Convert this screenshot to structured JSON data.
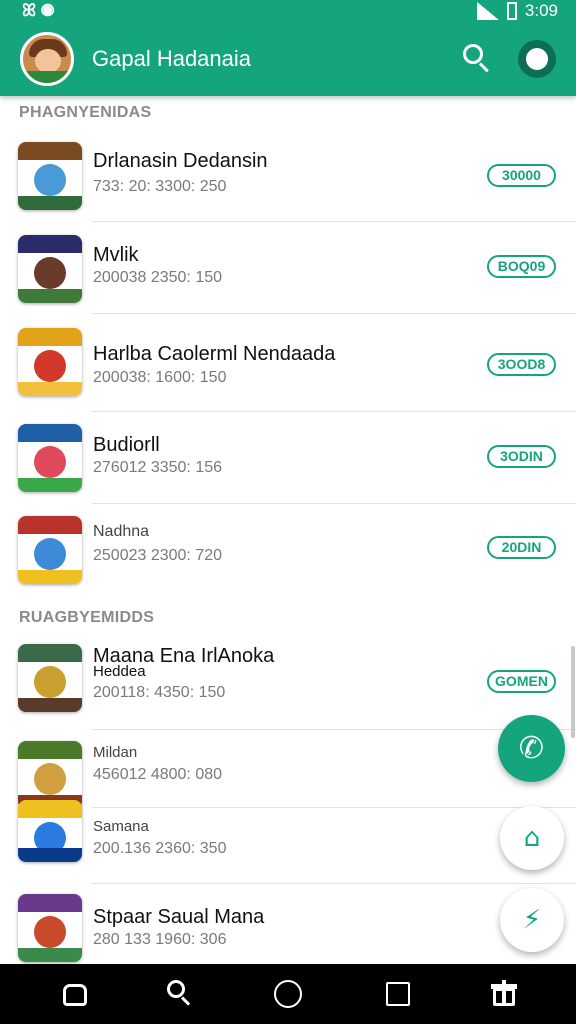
{
  "status_bar": {
    "left": "ꕤ ◉",
    "time": "3:09"
  },
  "app_bar": {
    "title": "Gapal Hadanaia",
    "search_icon": "search-icon",
    "profile_icon": "profile-icon"
  },
  "sections": [
    {
      "header": "PHAGNYENIDAS"
    },
    {
      "header": "RUAGBYEMIDDS"
    }
  ],
  "apps": [
    {
      "name": "Drlanasin Dedansin",
      "meta": "733: 20: 3300: 250",
      "badge": "30000",
      "colors": [
        "#2f6b3c",
        "#4a9ad6",
        "#7a4a22"
      ]
    },
    {
      "name": "Mvlik",
      "meta": "200038 2350: 150",
      "badge": "BOQ09",
      "colors": [
        "#2b2a6a",
        "#3f7a3a",
        "#6a3a2a"
      ]
    },
    {
      "name": "Harlba Caolerml Nendaada",
      "meta": "200038: 1600: 150",
      "badge": "3OOD8",
      "colors": [
        "#e2a21a",
        "#d13a2a",
        "#f2c03a"
      ]
    },
    {
      "name": "Budiorll",
      "meta": "276012 3350: 156",
      "badge": "3ODIN",
      "colors": [
        "#1f5fa8",
        "#e04a5a",
        "#3aa84a"
      ]
    },
    {
      "name": "Nadhna",
      "meta": "250023 2300: 720",
      "badge": "20DIN",
      "colors": [
        "#b8342a",
        "#3f8ad6",
        "#f0c020"
      ]
    },
    {
      "name": "Maana Ena IrlAnoka",
      "name2": "Heddea",
      "meta": "200118: 4350: 150",
      "badge": "GOMEN",
      "colors": [
        "#3a6a4a",
        "#c8a030",
        "#5a3a2a"
      ]
    },
    {
      "name": "Mildan",
      "meta": "456012 4800: 080",
      "badge": "",
      "colors": [
        "#4a7a2a",
        "#d0a040",
        "#8a3a1a"
      ]
    },
    {
      "name": "Samana",
      "meta": "200.136 2360: 350",
      "badge": "",
      "colors": [
        "#0a3a8a",
        "#2a7ae0",
        "#f0c020"
      ]
    },
    {
      "name": "Stpaar Saual Mana",
      "meta": "280 133 1960: 306",
      "badge": "",
      "colors": [
        "#6a3a8a",
        "#3a8a4a",
        "#c84a2a"
      ]
    }
  ],
  "fabs": {
    "primary_icon": "phone-icon",
    "primary_glyph": "✆",
    "mini1_icon": "house-icon",
    "mini1_glyph": "⌂",
    "mini2_icon": "bolt-icon",
    "mini2_glyph": "⚡"
  },
  "bottom_nav": [
    "home-icon",
    "search-icon",
    "circle-icon",
    "square-icon",
    "gift-icon"
  ],
  "accent_color": "#15a57e"
}
